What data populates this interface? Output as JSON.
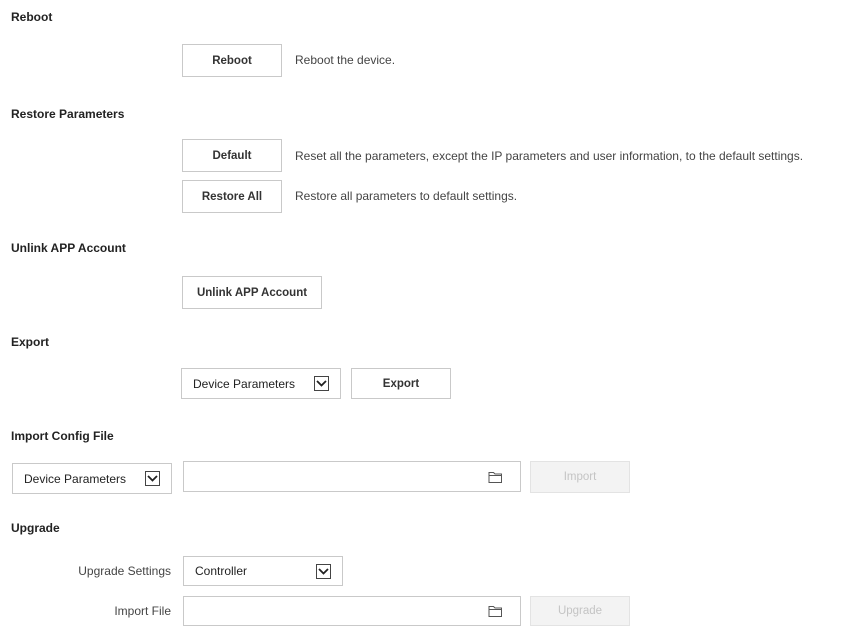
{
  "reboot": {
    "title": "Reboot",
    "button_label": "Reboot",
    "description": "Reboot the device."
  },
  "restore": {
    "title": "Restore Parameters",
    "default_button_label": "Default",
    "default_description": "Reset all the parameters, except the IP parameters and user information, to the default settings.",
    "restore_all_button_label": "Restore All",
    "restore_all_description": "Restore all parameters to default settings."
  },
  "unlink": {
    "title": "Unlink APP Account",
    "button_label": "Unlink APP Account"
  },
  "export": {
    "title": "Export",
    "select_value": "Device Parameters",
    "button_label": "Export"
  },
  "import_config": {
    "title": "Import Config File",
    "select_value": "Device Parameters",
    "file_value": "",
    "button_label": "Import"
  },
  "upgrade": {
    "title": "Upgrade",
    "settings_label": "Upgrade Settings",
    "settings_value": "Controller",
    "import_file_label": "Import File",
    "file_value": "",
    "button_label": "Upgrade"
  },
  "icons": {
    "dropdown": "chevron-down-icon",
    "file_browse": "folder-icon"
  },
  "colors": {
    "border": "#c9c9c9",
    "disabled_text": "#c4c4c4",
    "disabled_bg": "#f3f3f3"
  }
}
